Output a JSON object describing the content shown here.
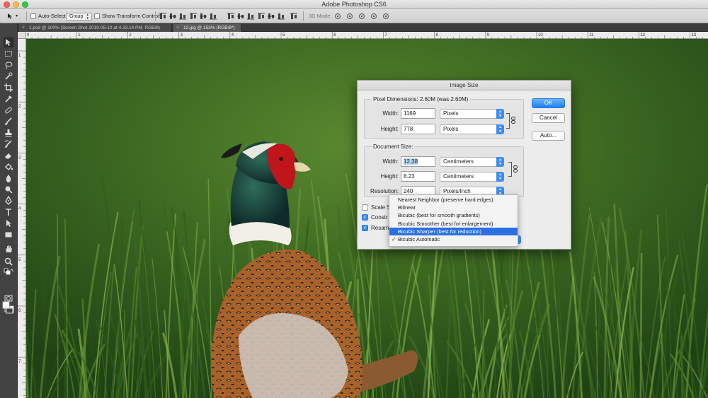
{
  "window": {
    "app_title": "Adobe Photoshop CS6"
  },
  "options_bar": {
    "auto_select_label": "Auto-Select:",
    "auto_select_value": "Group",
    "show_transform_label": "Show Transform Controls",
    "mode_3d_label": "3D Mode:"
  },
  "doc_tabs": [
    {
      "label": "1.psd @ 100% (Screen Shot 2019-05-10 at 4.33.14 PM, RGB/8)",
      "active": false
    },
    {
      "label": "12.jpg @ 153% (RGB/8*)",
      "active": true
    }
  ],
  "ruler": {
    "h_labels": [
      "0",
      "1",
      "2",
      "3",
      "4",
      "5",
      "6",
      "7",
      "8",
      "9",
      "10",
      "11",
      "12",
      "13"
    ],
    "v_labels": [
      "1",
      "2",
      "3",
      "4",
      "5",
      "6",
      "7",
      "8"
    ]
  },
  "dialog": {
    "title": "Image Size",
    "pixel_dimensions": {
      "title": "Pixel Dimensions:",
      "summary": "2.60M (was 2.60M)",
      "width_label": "Width:",
      "width_value": "1169",
      "width_unit": "Pixels",
      "height_label": "Height:",
      "height_value": "778",
      "height_unit": "Pixels"
    },
    "document_size": {
      "title": "Document Size:",
      "width_label": "Width:",
      "width_value": "12.38",
      "width_unit": "Centimeters",
      "height_label": "Height:",
      "height_value": "8.23",
      "height_unit": "Centimeters",
      "resolution_label": "Resolution:",
      "resolution_value": "240",
      "resolution_unit": "Pixels/Inch"
    },
    "checkboxes": [
      {
        "label": "Scale S",
        "checked": false
      },
      {
        "label": "Constr",
        "checked": true
      },
      {
        "label": "Resam",
        "checked": true
      }
    ],
    "buttons": {
      "ok": "OK",
      "cancel": "Cancel",
      "auto": "Auto..."
    }
  },
  "resample_menu": {
    "items": [
      {
        "label": "Nearest Neighbor (preserve hard edges)",
        "highlighted": false,
        "checked": false
      },
      {
        "label": "Bilinear",
        "highlighted": false,
        "checked": false
      },
      {
        "label": "Bicubic (best for smooth gradients)",
        "highlighted": false,
        "checked": false
      },
      {
        "label": "Bicubic Smoother (best for enlargement)",
        "highlighted": false,
        "checked": false
      },
      {
        "label": "Bicubic Sharper (best for reduction)",
        "highlighted": true,
        "checked": false
      },
      {
        "label": "Bicubic Automatic",
        "highlighted": false,
        "checked": true
      }
    ],
    "check_glyph": "✓"
  },
  "colors": {
    "accent": "#3d8ff1",
    "menu_highlight": "#2a70e0",
    "grass": "#3a6420"
  }
}
